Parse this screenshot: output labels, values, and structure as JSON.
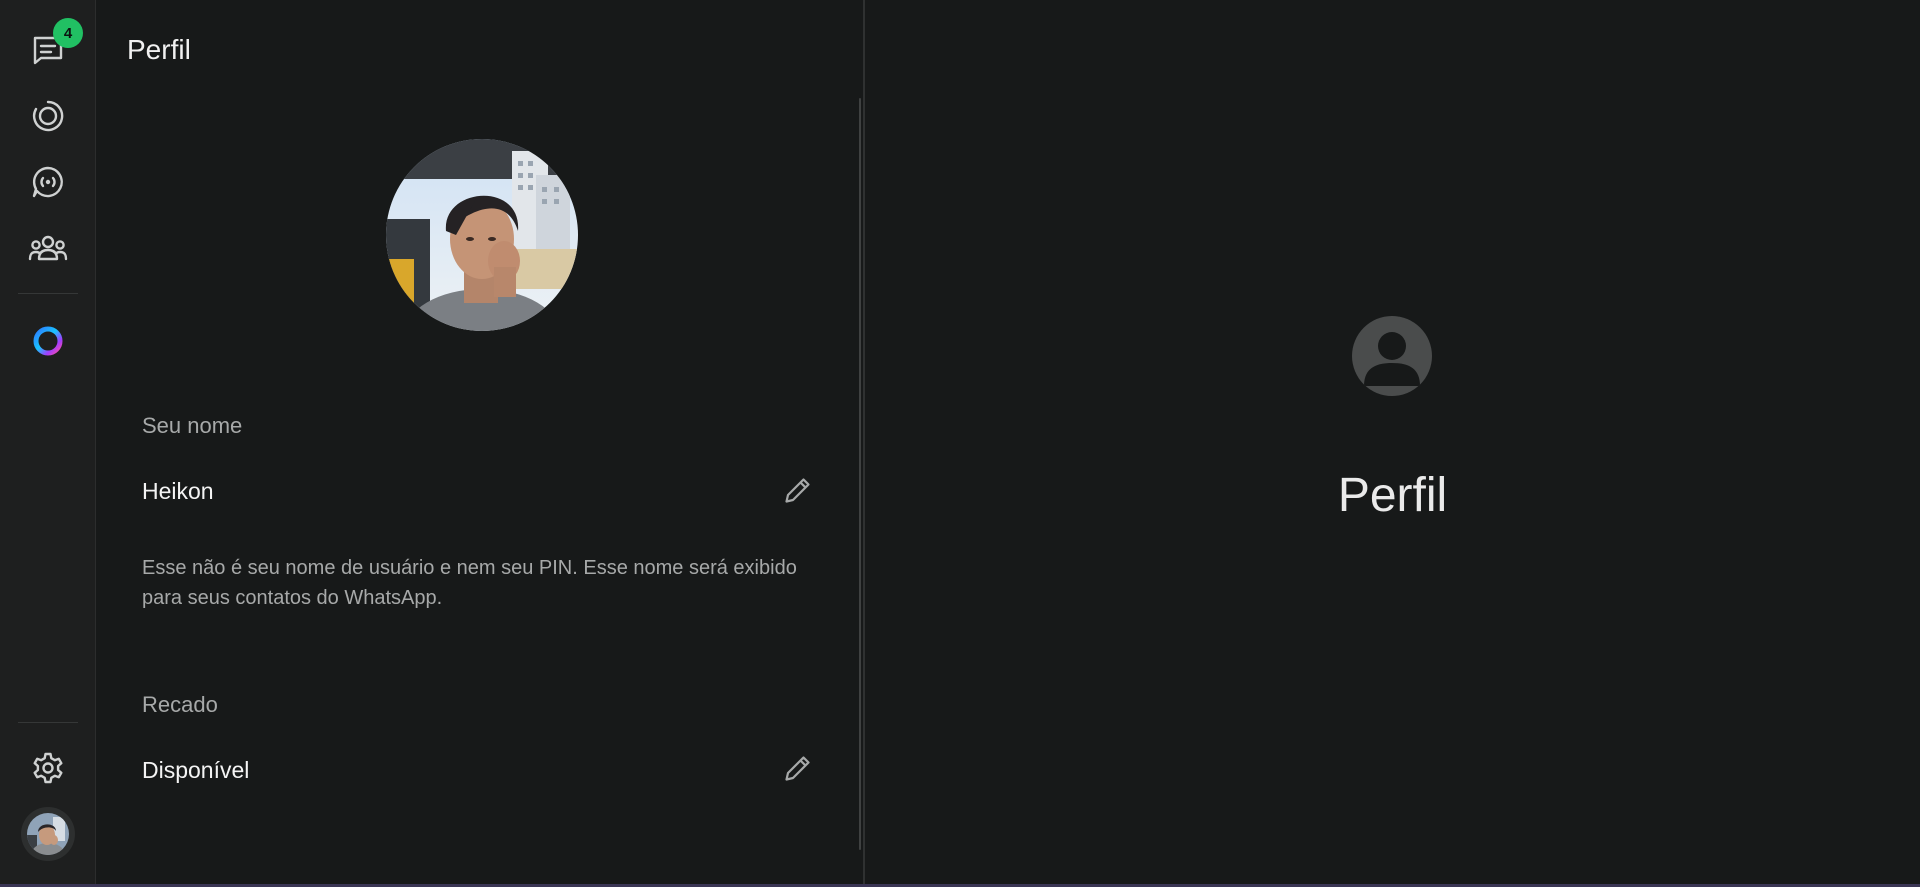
{
  "rail": {
    "chats_badge": "4",
    "items": [
      {
        "icon": "chats-icon"
      },
      {
        "icon": "status-icon"
      },
      {
        "icon": "channels-icon"
      },
      {
        "icon": "communities-icon"
      },
      {
        "icon": "meta-ai-icon"
      }
    ],
    "bottom": [
      {
        "icon": "settings-icon"
      },
      {
        "icon": "profile-avatar"
      }
    ]
  },
  "profile": {
    "title": "Perfil",
    "name_label": "Seu nome",
    "name_value": "Heikon",
    "name_help": "Esse não é seu nome de usuário e nem seu PIN. Esse nome será exibido para seus contatos do WhatsApp.",
    "about_label": "Recado",
    "about_value": "Disponível"
  },
  "detail": {
    "title": "Perfil",
    "icon": "person-placeholder-icon"
  },
  "colors": {
    "background": "#171919",
    "rail_background": "#1e1f1f",
    "badge": "#21c063",
    "text_primary": "#f4f4f4",
    "text_secondary": "#a7a9a9",
    "placeholder_icon": "#4a4c4c"
  }
}
